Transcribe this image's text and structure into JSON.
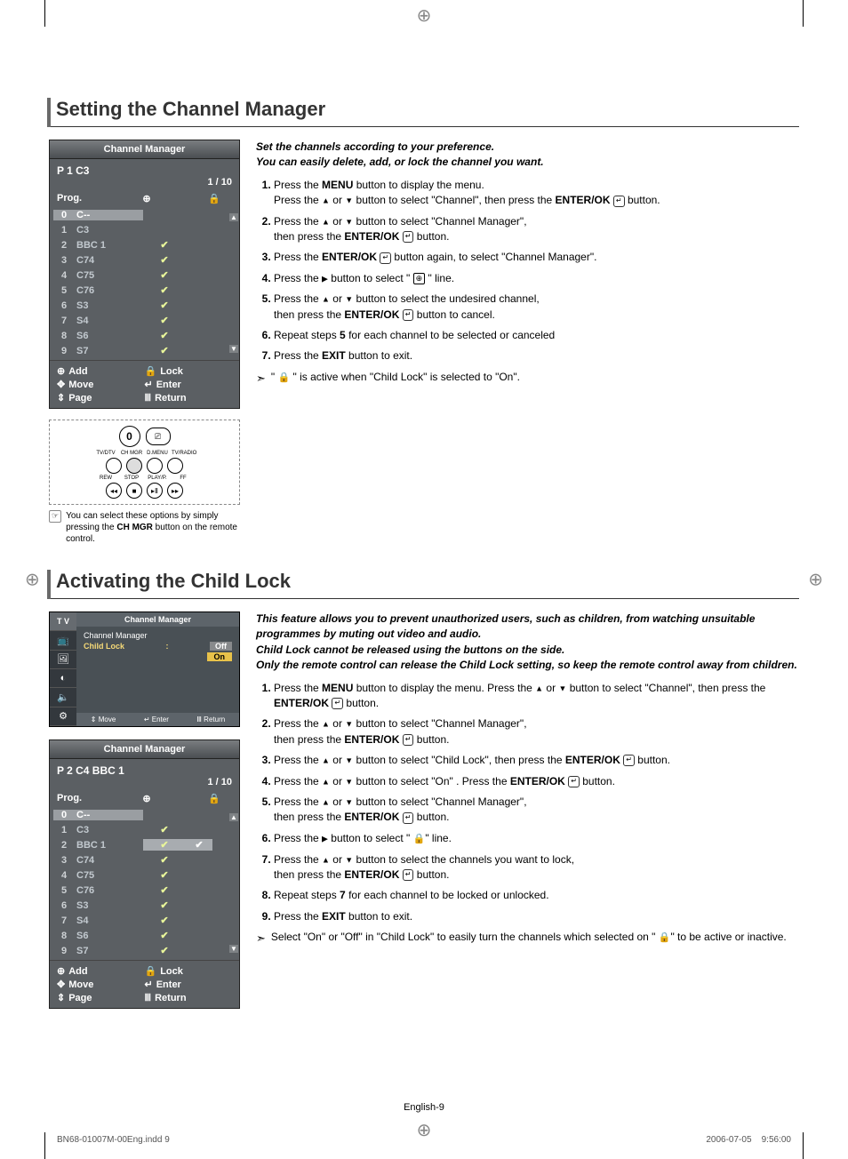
{
  "page": {
    "number_label": "English-9",
    "footer_left": "BN68-01007M-00Eng.indd   9",
    "footer_right": "2006-07-05      9:56:00"
  },
  "section1": {
    "title": "Setting the Channel Manager",
    "intro_line1": "Set the channels according to your preference.",
    "intro_line2": "You can easily delete, add, or lock the channel you want.",
    "steps": [
      "Press the <b>MENU</b> button to display the menu.<br>Press the <span class='tri'>▲</span> or <span class='tri'>▼</span> button to select \"Channel\", then press the <b>ENTER/OK</b> <span class='enter-icon'></span> button.",
      "Press the <span class='tri'>▲</span> or <span class='tri'>▼</span> button to select \"Channel Manager\",<br>then press the <b>ENTER/OK</b> <span class='enter-icon'></span> button.",
      "Press the <b>ENTER/OK</b> <span class='enter-icon'></span> button again, to select \"Channel Manager\".",
      "Press the <span class='tri'>▶</span> button to select \" <span class='inline-icon'>⊕</span> \" line.",
      "Press the <span class='tri'>▲</span> or <span class='tri'>▼</span> button to select the undesired channel,<br>then press the <b>ENTER/OK</b> <span class='enter-icon'></span> button to cancel.",
      "Repeat steps <b>5</b> for each channel to be selected or canceled",
      "Press the <b>EXIT</b> button to exit."
    ],
    "note": "\" <span style='font-size:11px'>🔒</span> \" is active when \"Child Lock\" is selected to \"On\".",
    "remote_note": "You can select these options by simply pressing the <b>CH MGR</b> button on the remote control.",
    "remote_labels": [
      "TV/DTV",
      "CH MGR",
      "D.MENU",
      "TV/RADIO",
      "REW",
      "STOP",
      "PLAY/P.",
      "FF"
    ],
    "osd": {
      "title": "Channel Manager",
      "status": "P  1   C3",
      "pager": "1 / 10",
      "col_prog": "Prog.",
      "rows": [
        {
          "idx": "0",
          "name": "C--",
          "tick": false,
          "lock": false,
          "hl": true
        },
        {
          "idx": "1",
          "name": "C3",
          "tick": false,
          "lock": false,
          "sel": true
        },
        {
          "idx": "2",
          "name": "BBC 1",
          "tick": true,
          "lock": false
        },
        {
          "idx": "3",
          "name": "C74",
          "tick": true,
          "lock": false
        },
        {
          "idx": "4",
          "name": "C75",
          "tick": true,
          "lock": false
        },
        {
          "idx": "5",
          "name": "C76",
          "tick": true,
          "lock": false
        },
        {
          "idx": "6",
          "name": "S3",
          "tick": true,
          "lock": false
        },
        {
          "idx": "7",
          "name": "S4",
          "tick": true,
          "lock": false
        },
        {
          "idx": "8",
          "name": "S6",
          "tick": true,
          "lock": false
        },
        {
          "idx": "9",
          "name": "S7",
          "tick": true,
          "lock": false
        }
      ],
      "legend": {
        "add": "Add",
        "lock": "Lock",
        "move": "Move",
        "enter": "Enter",
        "page": "Page",
        "return": "Return"
      }
    }
  },
  "section2": {
    "title": "Activating the Child Lock",
    "intro": [
      "This feature allows you to prevent unauthorized users, such as children, from watching unsuitable programmes by muting out video and audio.",
      "Child Lock cannot be released using the buttons on the side.",
      "Only the remote control can release the Child Lock setting, so keep the remote control away from children."
    ],
    "steps": [
      "Press the <b>MENU</b> button to display the menu.  Press the <span class='tri'>▲</span> or <span class='tri'>▼</span> button to select \"Channel\", then press the <b>ENTER/OK</b> <span class='enter-icon'></span> button.",
      "Press the <span class='tri'>▲</span> or <span class='tri'>▼</span> button to select \"Channel Manager\",<br>then press the <b>ENTER/OK</b> <span class='enter-icon'></span> button.",
      "Press the <span class='tri'>▲</span> or <span class='tri'>▼</span> button to select \"Child Lock\", then press the <b>ENTER/OK</b> <span class='enter-icon'></span> button.",
      "Press the <span class='tri'>▲</span> or <span class='tri'>▼</span> button to select \"On\" . Press the <b>ENTER/OK</b> <span class='enter-icon'></span> button.",
      "Press the <span class='tri'>▲</span> or <span class='tri'>▼</span> button to select \"Channel Manager\",<br>then press the <b>ENTER/OK</b> <span class='enter-icon'></span> button.",
      "Press the <span class='tri'>▶</span> button to select \" <span style='font-size:11px'>🔒</span>\" line.",
      "Press the <span class='tri'>▲</span> or <span class='tri'>▼</span> button to select the channels you want to lock,<br>then press the <b>ENTER/OK</b> <span class='enter-icon'></span> button.",
      "Repeat steps <b>7</b> for each channel to be locked or unlocked.",
      "Press the <b>EXIT</b> button to exit."
    ],
    "note": "Select \"On\" or \"Off\" in \"Child Lock\" to easily turn the channels which selected on \" <span style='font-size:11px'>🔒</span>\" to be active or inactive.",
    "mini_osd": {
      "side_label": "T V",
      "title": "Channel Manager",
      "row1": "Channel Manager",
      "row2_label": "Child Lock",
      "row2_sep": ":",
      "row2_opt1": "Off",
      "row2_opt2": "On",
      "foot_move": "Move",
      "foot_enter": "Enter",
      "foot_return": "Return"
    },
    "osd": {
      "title": "Channel Manager",
      "status": "P  2   C4      BBC 1",
      "pager": "1 / 10",
      "col_prog": "Prog.",
      "rows": [
        {
          "idx": "0",
          "name": "C--",
          "tick": false,
          "lock": false,
          "hl": true
        },
        {
          "idx": "1",
          "name": "C3",
          "tick": true,
          "lock": false
        },
        {
          "idx": "2",
          "name": "BBC 1",
          "tick": true,
          "lock": true,
          "sel": true
        },
        {
          "idx": "3",
          "name": "C74",
          "tick": true,
          "lock": false
        },
        {
          "idx": "4",
          "name": "C75",
          "tick": true,
          "lock": false
        },
        {
          "idx": "5",
          "name": "C76",
          "tick": true,
          "lock": false
        },
        {
          "idx": "6",
          "name": "S3",
          "tick": true,
          "lock": false
        },
        {
          "idx": "7",
          "name": "S4",
          "tick": true,
          "lock": false
        },
        {
          "idx": "8",
          "name": "S6",
          "tick": true,
          "lock": false
        },
        {
          "idx": "9",
          "name": "S7",
          "tick": true,
          "lock": false
        }
      ],
      "legend": {
        "add": "Add",
        "lock": "Lock",
        "move": "Move",
        "enter": "Enter",
        "page": "Page",
        "return": "Return"
      }
    }
  }
}
